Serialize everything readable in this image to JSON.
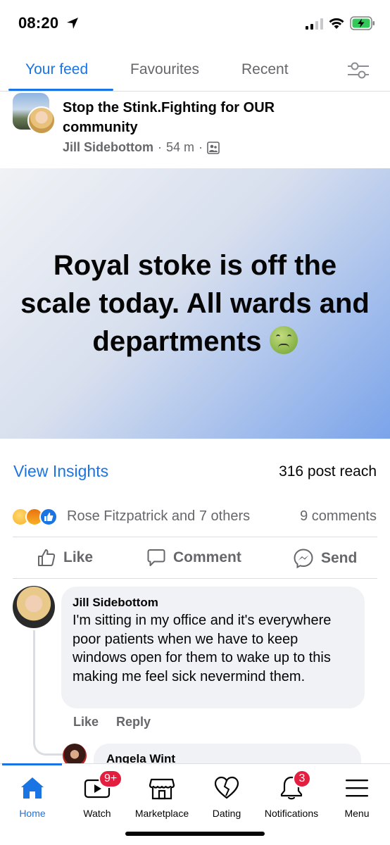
{
  "status_bar": {
    "time": "08:20",
    "icons": [
      "location-arrow-icon",
      "cellular-signal-icon",
      "wifi-icon",
      "battery-charging-icon"
    ]
  },
  "tabs": {
    "items": [
      {
        "label": "Your feed",
        "active": true
      },
      {
        "label": "Favourites",
        "active": false
      },
      {
        "label": "Recent",
        "active": false
      }
    ],
    "settings_icon": "filter-sliders-icon",
    "accent_color": "#1b74e4"
  },
  "post": {
    "group_name": "Stop the Stink.Fighting for OUR community",
    "author": "Jill Sidebottom",
    "time": "54 m",
    "separator": "·",
    "audience_icon": "group-members-icon",
    "text": "Royal stoke is off the scale today. All wards and departments",
    "text_emoji": "nauseated-face-emoji",
    "background_colors": [
      "#f0f2f5",
      "#7ba4ea"
    ]
  },
  "insights": {
    "link_label": "View Insights",
    "reach": "316 post reach"
  },
  "reactions": {
    "icons": [
      "sad-reaction-icon",
      "angry-reaction-icon",
      "like-reaction-icon"
    ],
    "names": "Rose Fitzpatrick and 7 others",
    "comments": "9 comments"
  },
  "actions": {
    "like": "Like",
    "comment": "Comment",
    "send": "Send"
  },
  "comments": [
    {
      "author": "Jill Sidebottom",
      "text": "I'm sitting in my office and it's everywhere  poor patients when we have to keep windows open for them to wake up to this  making me feel sick nevermind them.",
      "like_label": "Like",
      "reply_label": "Reply"
    }
  ],
  "reply": {
    "author": "Angela Wint"
  },
  "bottom_nav": {
    "items": [
      {
        "label": "Home",
        "icon": "home-icon",
        "active": true
      },
      {
        "label": "Watch",
        "icon": "watch-video-icon",
        "badge": "9+"
      },
      {
        "label": "Marketplace",
        "icon": "marketplace-shop-icon"
      },
      {
        "label": "Dating",
        "icon": "dating-heart-icon"
      },
      {
        "label": "Notifications",
        "icon": "bell-icon",
        "badge": "3"
      },
      {
        "label": "Menu",
        "icon": "hamburger-menu-icon"
      }
    ]
  }
}
